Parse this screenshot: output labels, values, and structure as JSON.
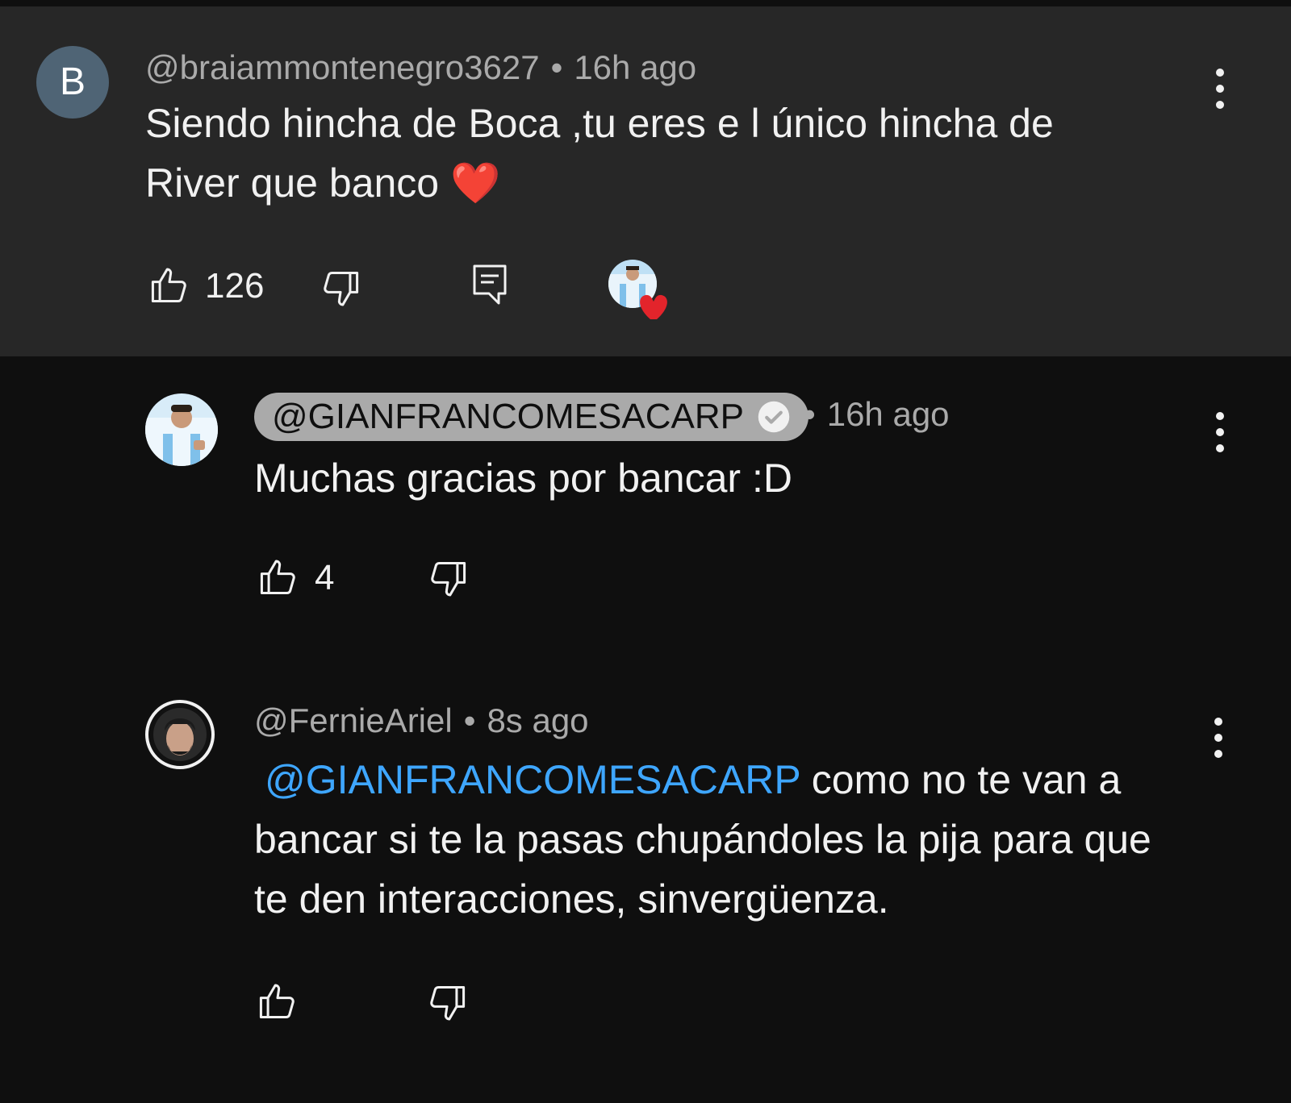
{
  "thread": [
    {
      "avatar_letter": "B",
      "avatar_color": "#4f6475",
      "author": "@braiammontenegro3627",
      "time": "16h ago",
      "text": "Siendo hincha de Boca ,tu eres e l único hincha de River que banco ❤️",
      "likes": "126",
      "icons": [
        "thumb-up-icon",
        "thumb-down-icon",
        "reply-icon",
        "creator-heart-icon",
        "more-vert-icon"
      ]
    },
    {
      "author": "@GIANFRANCOMESACARP",
      "verified": true,
      "time": "16h ago",
      "text": "Muchas gracias por bancar :D",
      "likes": "4",
      "icons": [
        "thumb-up-icon",
        "thumb-down-icon",
        "more-vert-icon",
        "verified-check-icon"
      ]
    },
    {
      "author": "@FernieAriel",
      "time": "8s ago",
      "mention": "@GIANFRANCOMESACARP",
      "text": " como no te van a bancar si te la pasas chupándoles la pija para que te den interacciones, sinvergüenza.",
      "likes": "",
      "icons": [
        "thumb-up-icon",
        "thumb-down-icon",
        "more-vert-icon"
      ]
    }
  ],
  "colors": {
    "background": "#0f0f0f",
    "highlight_background": "#272727",
    "secondary_text": "#aaaaaa",
    "mention": "#3ea6ff",
    "heart": "#e3242b"
  }
}
